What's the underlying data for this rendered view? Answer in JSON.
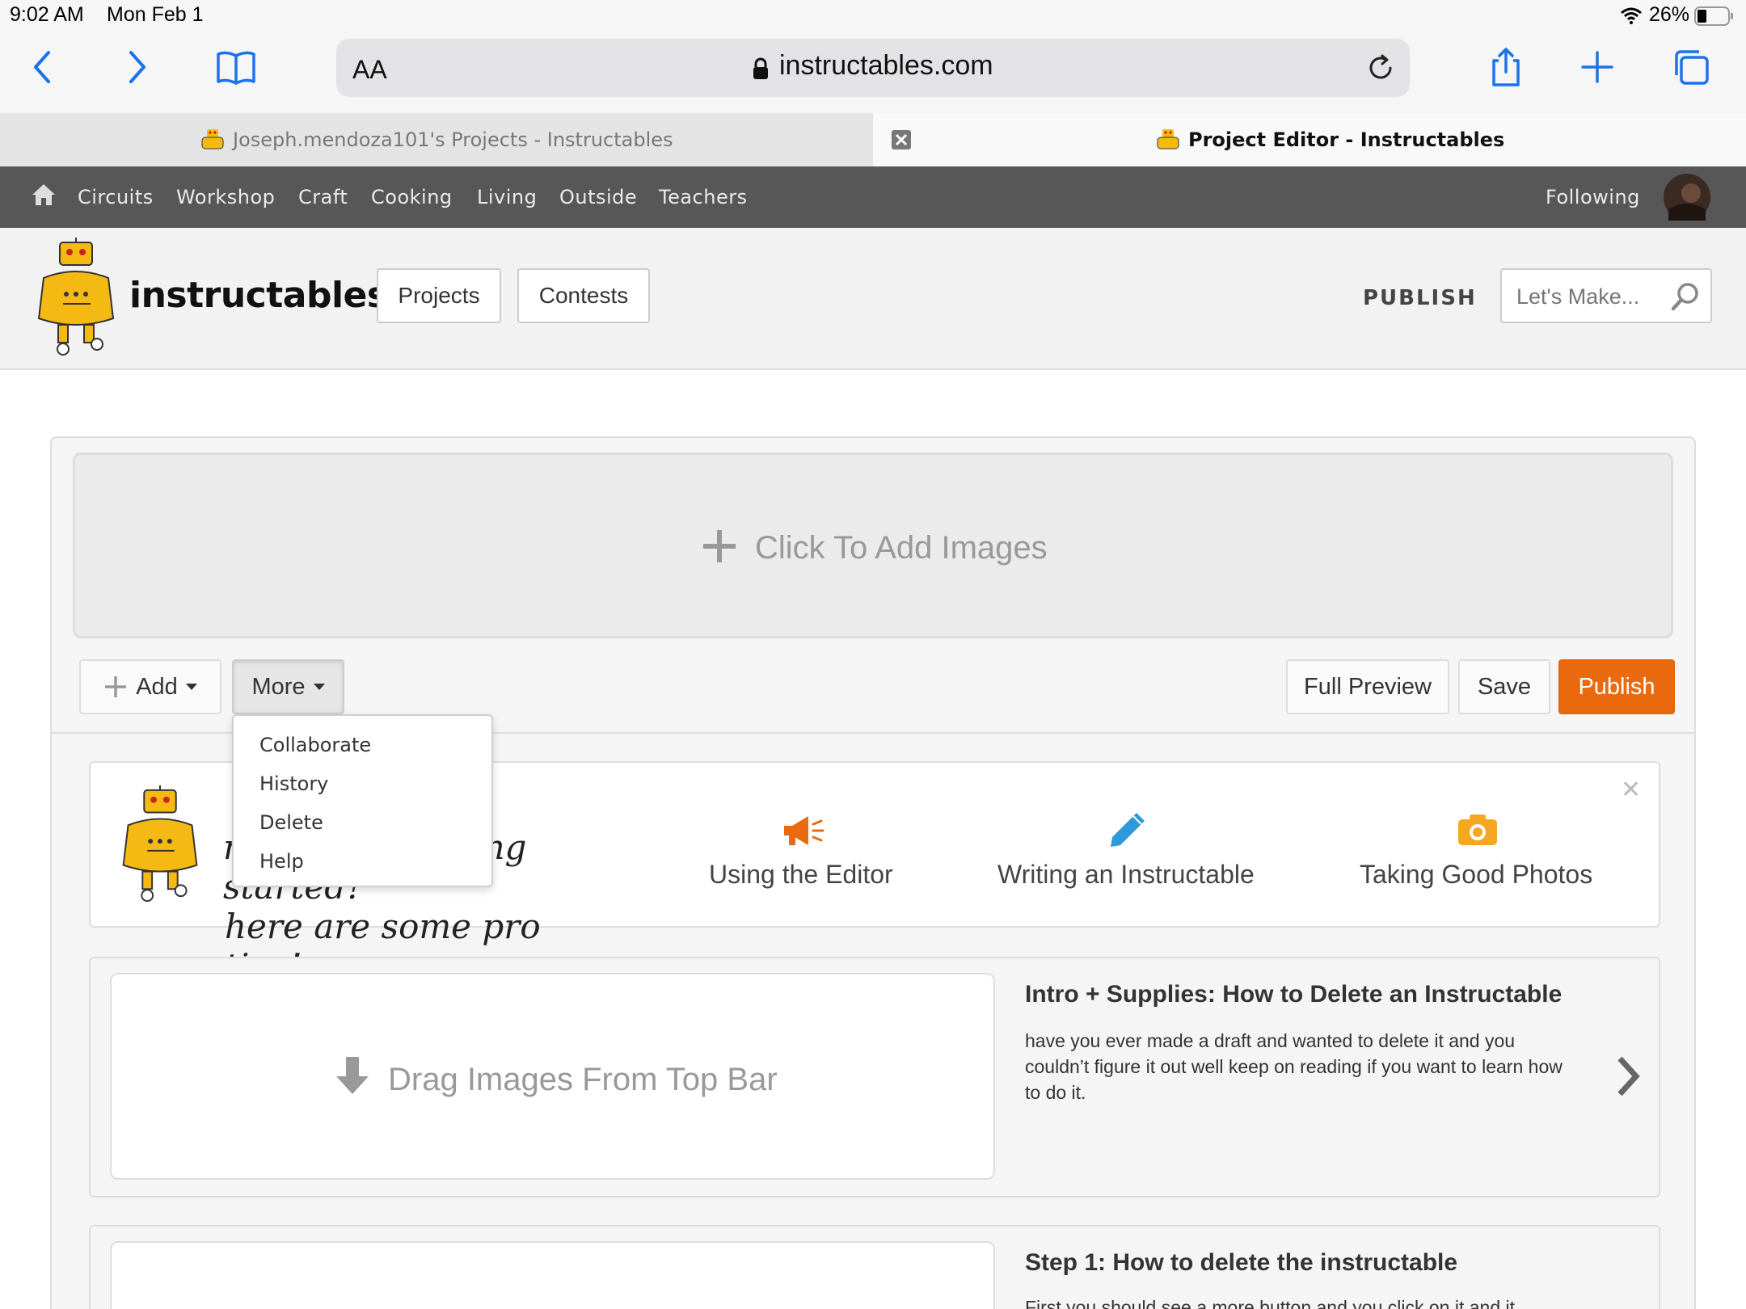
{
  "status_bar": {
    "time": "9:02 AM",
    "date": "Mon Feb 1",
    "battery": "26%"
  },
  "browser": {
    "aa_label": "AA",
    "url": "instructables.com",
    "tabs": [
      {
        "title": "Joseph.mendoza101's Projects - Instructables",
        "active": false
      },
      {
        "title": "Project Editor - Instructables",
        "active": true
      }
    ]
  },
  "site_nav": {
    "items": [
      "Circuits",
      "Workshop",
      "Craft",
      "Cooking",
      "Living",
      "Outside",
      "Teachers"
    ],
    "following": "Following"
  },
  "header": {
    "logo_text": "instructables",
    "projects": "Projects",
    "contests": "Contests",
    "publish": "PUBLISH",
    "search_placeholder": "Let's Make..."
  },
  "editor": {
    "add_images": "Click To Add Images",
    "add": "Add",
    "more": "More",
    "full_preview": "Full Preview",
    "save": "Save",
    "publish": "Publish",
    "more_menu": [
      "Collaborate",
      "History",
      "Delete",
      "Help"
    ]
  },
  "tips": {
    "heading_line1": "need help getting started?",
    "heading_line2": "here are some pro tips!",
    "items": [
      "Using the Editor",
      "Writing an Instructable",
      "Taking Good Photos"
    ]
  },
  "steps": [
    {
      "drop_label": "Drag Images From Top Bar",
      "title": "Intro + Supplies: How to Delete an Instructable",
      "body": "have you ever made a draft and wanted to delete it and you couldn’t figure it out well keep on reading if you want to learn how to do it."
    },
    {
      "title": "Step 1: How to delete the instructable",
      "body": "First you should see a more button and you click on it and it"
    }
  ],
  "colors": {
    "accent": "#ea6a0f",
    "nav_bg": "#575757",
    "safari_blue": "#1a73e8"
  }
}
